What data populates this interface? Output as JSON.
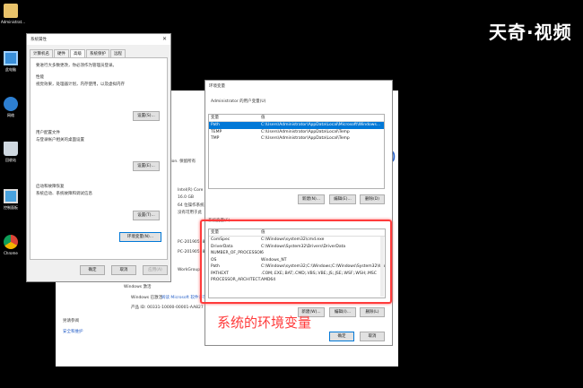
{
  "brand": "天奇·视频",
  "desktop": [
    {
      "label": "Administrat...",
      "icon": "user-folder-icon"
    },
    {
      "label": "此电脑",
      "icon": "computer-icon"
    },
    {
      "label": "网络",
      "icon": "network-icon"
    },
    {
      "label": "回收站",
      "icon": "recycle-bin-icon"
    },
    {
      "label": "控制面板",
      "icon": "control-panel-icon"
    },
    {
      "label": "Chrome",
      "icon": "chrome-icon"
    }
  ],
  "system_props": {
    "title": "系统属性",
    "tabs": [
      "计算机名",
      "硬件",
      "高级",
      "系统保护",
      "远程"
    ],
    "intro": "要进行大多数更改，你必须作为管理员登录。",
    "performance": {
      "title": "性能",
      "desc": "视觉效果，处理器计划，内存使用，以及虚拟内存",
      "button": "设置(S)..."
    },
    "profile": {
      "title": "用户配置文件",
      "desc": "与登录帐户相关的桌面设置",
      "button": "设置(E)..."
    },
    "startup": {
      "title": "启动和故障恢复",
      "desc": "系统启动、系统故障和调试信息",
      "button": "设置(T)..."
    },
    "env_button": "环境变量(N)...",
    "ok": "确定",
    "cancel": "取消",
    "apply": "应用(A)"
  },
  "background": {
    "r1": "ration. 保留所有",
    "r2": "Intel(R) Core",
    "r3": "16.0 GB",
    "r4": "64 位操作系统",
    "r5": "没有可用于此",
    "r6": "PC-20190528",
    "r7": "PC-20190528",
    "r8": "WorkGroup",
    "windows_title": "Windows 激活",
    "windows_line": "Windows 已激活",
    "windows_link": "阅读 Microsoft 软件许可条款",
    "product_id": "产品 ID: 00331-10000-00001-AA827",
    "see_also": "另请参阅",
    "security": "安全和维护",
    "side": "0"
  },
  "env": {
    "title": "环境变量",
    "user_section": "Administrator 的用户变量(U)",
    "col_var": "变量",
    "col_val": "值",
    "user_vars": [
      {
        "name": "Path",
        "value": "C:\\Users\\Administrator\\AppData\\Local\\Microsoft\\Windows..."
      },
      {
        "name": "TEMP",
        "value": "C:\\Users\\Administrator\\AppData\\Local\\Temp"
      },
      {
        "name": "TMP",
        "value": "C:\\Users\\Administrator\\AppData\\Local\\Temp"
      }
    ],
    "new": "新建(N)...",
    "edit": "编辑(E)...",
    "delete": "删除(D)",
    "system_section": "系统变量(S)",
    "sys_vars": [
      {
        "name": "ComSpec",
        "value": "C:\\Windows\\system32\\cmd.exe"
      },
      {
        "name": "DriverData",
        "value": "C:\\Windows\\System32\\Drivers\\DriverData"
      },
      {
        "name": "NUMBER_OF_PROCESSORS",
        "value": "6"
      },
      {
        "name": "OS",
        "value": "Windows_NT"
      },
      {
        "name": "Path",
        "value": "C:\\Windows\\system32;C:\\Windows;C:\\Windows\\System32\\Wb..."
      },
      {
        "name": "PATHEXT",
        "value": ".COM;.EXE;.BAT;.CMD;.VBS;.VBE;.JS;.JSE;.WSF;.WSH;.MSC"
      },
      {
        "name": "PROCESSOR_ARCHITECT...",
        "value": "AMD64"
      }
    ],
    "new2": "新建(W)...",
    "edit2": "编辑(I)...",
    "delete2": "删除(L)",
    "ok": "确定",
    "cancel": "取消"
  },
  "annotation": "系统的环境变量",
  "colors": {
    "accent": "#0078d7",
    "highlight": "#ff3b3b"
  }
}
